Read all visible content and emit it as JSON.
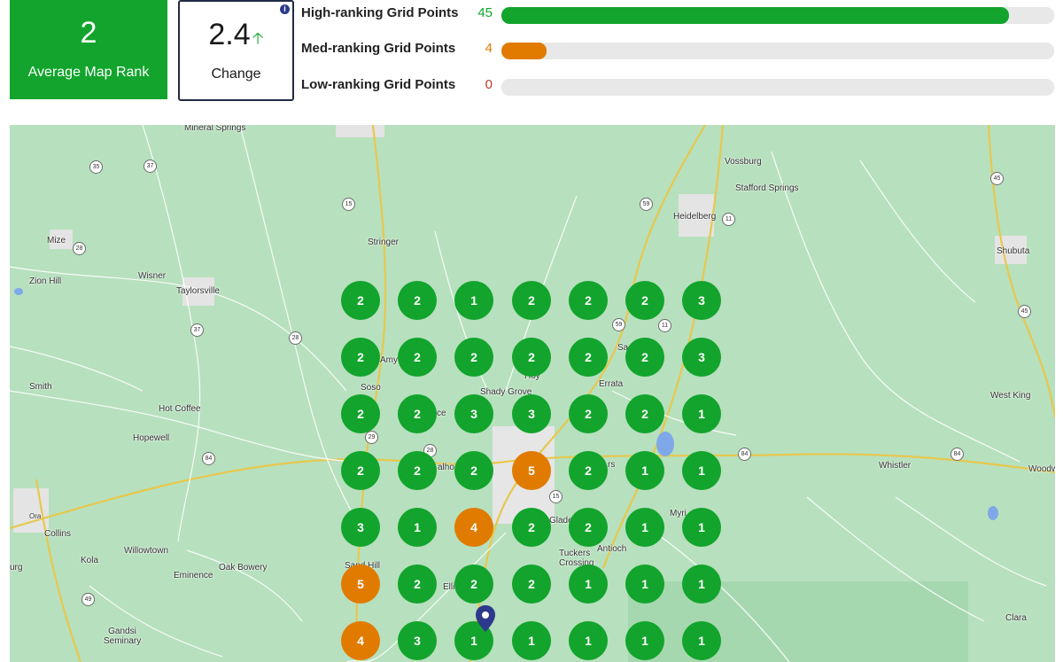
{
  "summary": {
    "average_rank": "2",
    "average_label": "Average Map Rank",
    "change_value": "2.4",
    "change_label": "Change",
    "info_icon": "i"
  },
  "bars": [
    {
      "label": "High-ranking Grid Points",
      "count": "45",
      "fraction": 0.918,
      "color": "#12a42c"
    },
    {
      "label": "Med-ranking Grid Points",
      "count": "4",
      "fraction": 0.082,
      "color": "#e07b00"
    },
    {
      "label": "Low-ranking Grid Points",
      "count": "0",
      "fraction": 0.0,
      "color": "#c0392b"
    }
  ],
  "colors": {
    "high": "#12a42c",
    "medium": "#e07b00",
    "low": "#c0392b",
    "marker": "#2d3a8c"
  },
  "map": {
    "towns": [
      "Mineral Springs",
      "Vossburg",
      "Stafford Springs",
      "Heidelberg",
      "Mize",
      "Stringer",
      "Shubuta",
      "Zion Hill",
      "Wisner",
      "Taylorsville",
      "Amy",
      "Soso",
      "Hoy",
      "Shady Grove",
      "Errata",
      "Smith",
      "Hot Coffee",
      "West King",
      "Hopewell",
      "Whistler",
      "Woodw",
      "Collins",
      "Ora",
      "Willowtown",
      "Kola",
      "Tuckers Crossing",
      "Antioch",
      "Myri",
      "Sand Hill",
      "Oak Bowery",
      "Eminence",
      "Ellis",
      "Gandsi Seminary",
      "urg",
      "Clara",
      "Glade",
      "alho",
      "rs",
      "ce",
      "Sa"
    ],
    "shields": [
      "35",
      "37",
      "15",
      "59",
      "11",
      "45",
      "28",
      "37",
      "28",
      "29",
      "28",
      "84",
      "15",
      "84",
      "84",
      "49",
      "59",
      "11",
      "45"
    ],
    "grid": [
      [
        "2",
        "2",
        "1",
        "2",
        "2",
        "2",
        "3"
      ],
      [
        "2",
        "2",
        "2",
        "2",
        "2",
        "2",
        "3"
      ],
      [
        "2",
        "2",
        "3",
        "3",
        "2",
        "2",
        "1"
      ],
      [
        "2",
        "2",
        "2",
        "5",
        "2",
        "1",
        "1"
      ],
      [
        "3",
        "1",
        "4",
        "2",
        "2",
        "1",
        "1"
      ],
      [
        "5",
        "2",
        "2",
        "2",
        "1",
        "1",
        "1"
      ],
      [
        "4",
        "3",
        "1",
        "1",
        "1",
        "1",
        "1"
      ]
    ]
  }
}
